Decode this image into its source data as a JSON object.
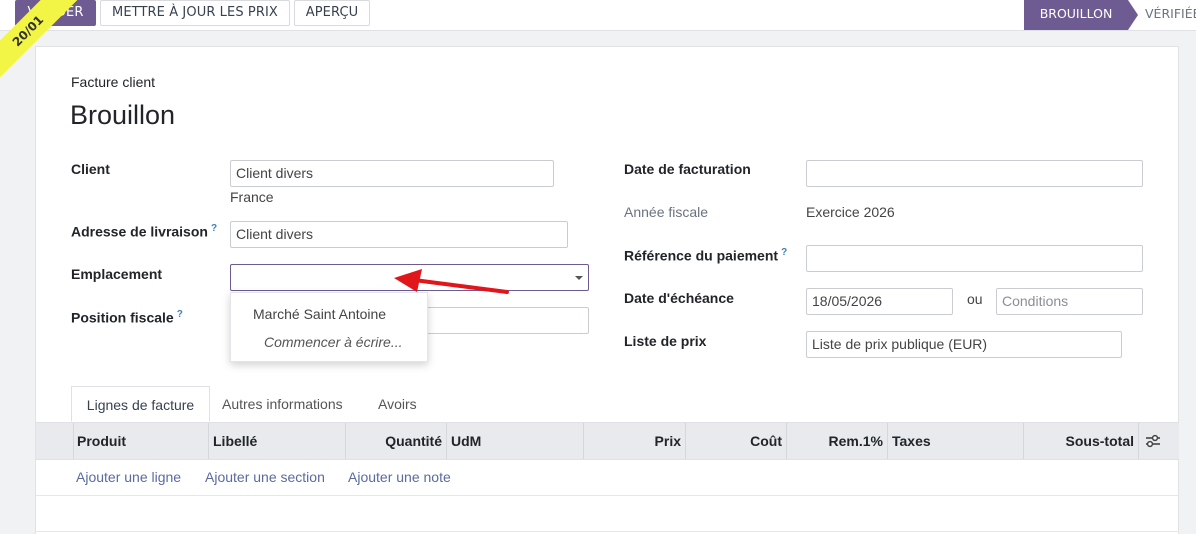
{
  "toolbar": {
    "validate": "VALIDER",
    "update_prices": "METTRE À JOUR LES PRIX",
    "preview": "APERÇU"
  },
  "statusbar": {
    "current": "BROUILLON",
    "next": "VÉRIFIÉE"
  },
  "ribbon": "20/01",
  "header": {
    "type": "Facture client",
    "title": "Brouillon"
  },
  "left_fields": {
    "client_label": "Client",
    "client_value": "Client divers",
    "client_country": "France",
    "shipping_label": "Adresse de livraison",
    "shipping_value": "Client divers",
    "location_label": "Emplacement",
    "location_value": "",
    "fiscal_label": "Position fiscale",
    "help_mark": "?"
  },
  "dropdown": {
    "item": "Marché Saint Antoine",
    "create": "Commencer à écrire..."
  },
  "right_fields": {
    "invoice_date_label": "Date de facturation",
    "invoice_date_value": "",
    "fiscal_year_label": "Année fiscale",
    "fiscal_year_value": "Exercice 2026",
    "payment_ref_label": "Référence du paiement",
    "due_date_label": "Date d'échéance",
    "due_date_value": "18/05/2026",
    "or": "ou",
    "terms_placeholder": "Conditions",
    "pricelist_label": "Liste de prix",
    "pricelist_value": "Liste de prix publique (EUR)"
  },
  "tabs": [
    "Lignes de facture",
    "Autres informations",
    "Avoirs"
  ],
  "table": {
    "columns": [
      "Produit",
      "Libellé",
      "Quantité",
      "UdM",
      "Prix",
      "Coût",
      "Rem.1%",
      "Taxes",
      "Sous-total"
    ],
    "actions": [
      "Ajouter une ligne",
      "Ajouter une section",
      "Ajouter une note"
    ]
  },
  "colors": {
    "primary": "#6e5b92",
    "ribbon": "#f3f545",
    "arrow": "#e0161b"
  }
}
